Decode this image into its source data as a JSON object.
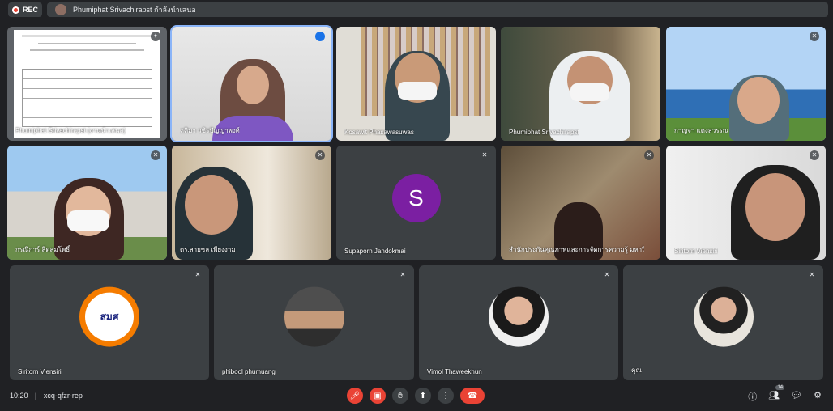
{
  "header": {
    "rec_label": "REC",
    "presenting_text": "Phumiphat Srivachirapst กำลังนำเสนอ"
  },
  "tiles": [
    {
      "name": "Phumiphat Srivachirapst (งานนำเสนอ)"
    },
    {
      "name": "ศศิมา วชิรปัญญาพงศ์"
    },
    {
      "name": "Kosawit Phasawasuwas"
    },
    {
      "name": "Phumiphat Srivachirapst"
    },
    {
      "name": "กาญจา แดงสวรรณ"
    },
    {
      "name": "กรณิการ์ ลีดสมโพธิ์"
    },
    {
      "name": "ดร.สายชล เพียงงาม"
    },
    {
      "name": "Supaporn Jandokmai",
      "initial": "S"
    },
    {
      "name": "สำนักประกันคุณภาพและการจัดการความรู้ มหาวิทยาลัยเท..."
    },
    {
      "name": "Siritorn Viensiri"
    },
    {
      "name": "Siritorn Viensiri",
      "logo_text": "สมศ"
    },
    {
      "name": "phibool phumuang"
    },
    {
      "name": "Vimol Thaweekhun"
    },
    {
      "name": "คุณ"
    }
  ],
  "footer": {
    "time": "10:20",
    "separator": "|",
    "meeting_code": "xcq-qfzr-rep",
    "participants_count": "14"
  },
  "colors": {
    "accent": "#8ab4f8",
    "red": "#ea4335",
    "tile": "#3c4043",
    "bg": "#202124"
  }
}
